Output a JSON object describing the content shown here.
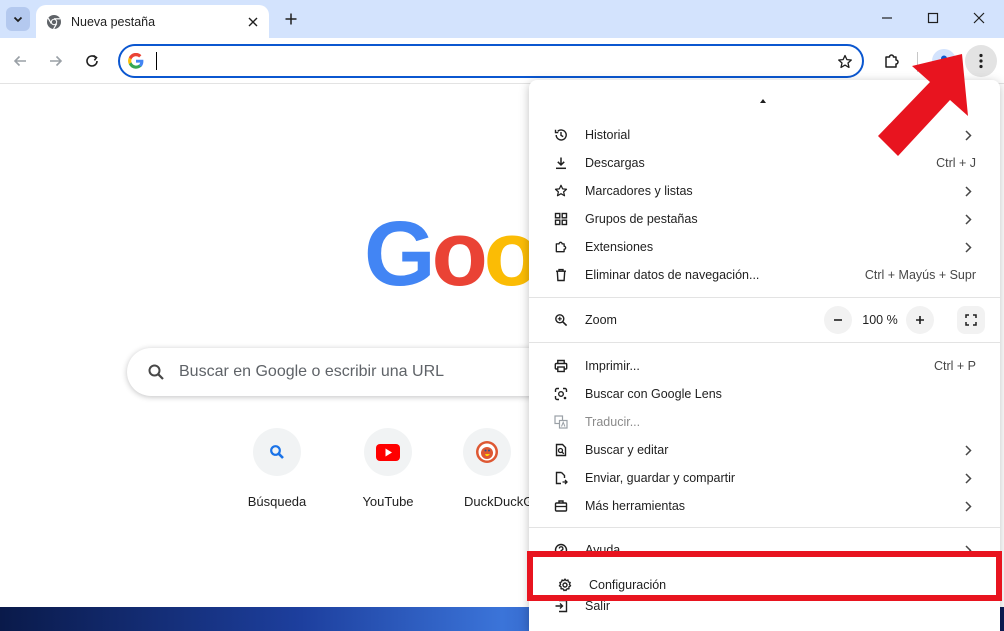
{
  "browser": {
    "tab": {
      "title": "Nueva pestaña"
    },
    "omnibox": {
      "value": "",
      "placeholder": ""
    }
  },
  "ntp": {
    "search_placeholder": "Buscar en Google o escribir una URL",
    "logo_letters": [
      "G",
      "o",
      "o"
    ],
    "logo_colors": [
      "#4285F4",
      "#EA4335",
      "#FBBC05"
    ],
    "shortcuts": [
      {
        "label": "Búsqueda",
        "icon": "search-icon"
      },
      {
        "label": "YouTube",
        "icon": "youtube-icon"
      },
      {
        "label": "DuckDuckGo",
        "icon": "duckduckgo-icon"
      }
    ]
  },
  "menu": {
    "group1": [
      {
        "label": "Historial",
        "icon": "history-icon",
        "submenu": true
      },
      {
        "label": "Descargas",
        "icon": "download-icon",
        "shortcut": "Ctrl + J"
      },
      {
        "label": "Marcadores y listas",
        "icon": "star-icon",
        "submenu": true
      },
      {
        "label": "Grupos de pestañas",
        "icon": "tab-groups-icon",
        "submenu": true
      },
      {
        "label": "Extensiones",
        "icon": "puzzle-icon",
        "submenu": true
      },
      {
        "label": "Eliminar datos de navegación...",
        "icon": "trash-icon",
        "shortcut": "Ctrl + Mayús + Supr"
      }
    ],
    "zoom": {
      "label": "Zoom",
      "value": "100 %"
    },
    "group2": [
      {
        "label": "Imprimir...",
        "icon": "print-icon",
        "shortcut": "Ctrl + P"
      },
      {
        "label": "Buscar con Google Lens",
        "icon": "lens-icon"
      },
      {
        "label": "Traducir...",
        "icon": "translate-icon",
        "disabled": true
      },
      {
        "label": "Buscar y editar",
        "icon": "find-icon",
        "submenu": true
      },
      {
        "label": "Enviar, guardar y compartir",
        "icon": "share-icon",
        "submenu": true
      },
      {
        "label": "Más herramientas",
        "icon": "toolbox-icon",
        "submenu": true
      }
    ],
    "group3": [
      {
        "label": "Ayuda",
        "icon": "help-icon",
        "submenu": true
      },
      {
        "label": "Configuración",
        "icon": "gear-icon"
      },
      {
        "label": "Salir",
        "icon": "exit-icon"
      }
    ]
  },
  "colors": {
    "accent": "#0b57d0",
    "annotation_red": "#e8141f",
    "tabstrip_bg": "#d3e3fd"
  }
}
